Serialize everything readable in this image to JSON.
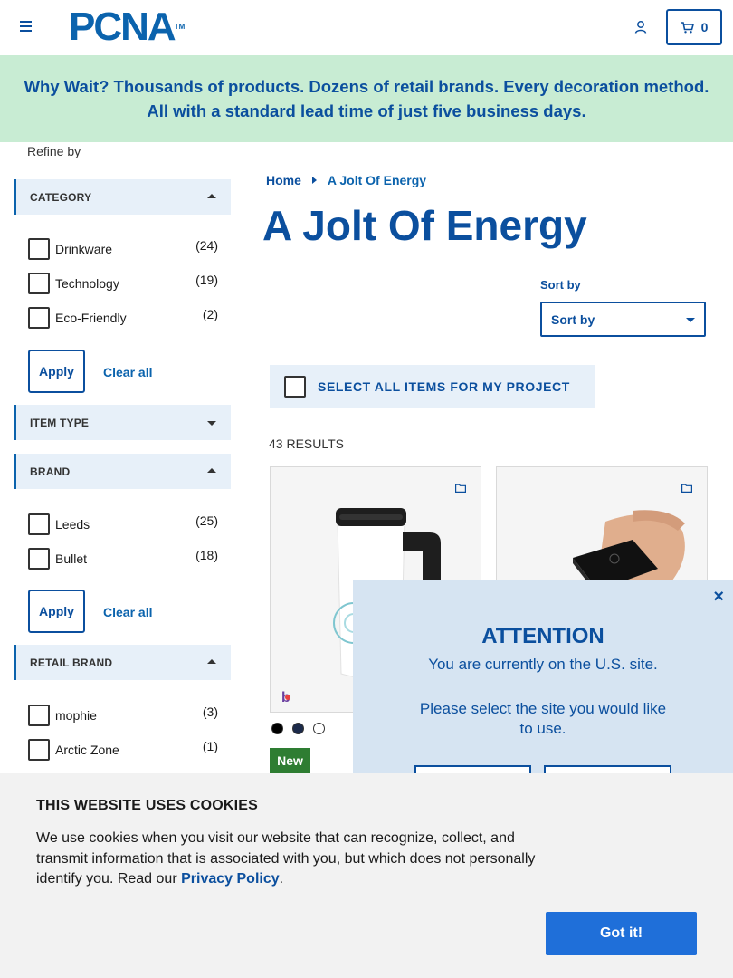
{
  "header": {
    "logo_text": "PCNA",
    "logo_tm": "TM",
    "cart_count": "0"
  },
  "banner": {
    "text": "Why Wait? Thousands of products. Dozens of retail brands. Every decoration method. All with a standard lead time of just five business days."
  },
  "sidebar": {
    "refine_label": "Refine by",
    "category": {
      "title": "CATEGORY",
      "options": [
        {
          "label": "Drinkware",
          "count": "(24)"
        },
        {
          "label": "Technology",
          "count": "(19)"
        },
        {
          "label": "Eco-Friendly",
          "count": "(2)"
        }
      ],
      "apply_label": "Apply",
      "clear_label": "Clear all"
    },
    "item_type": {
      "title": "ITEM TYPE"
    },
    "brand": {
      "title": "BRAND",
      "options": [
        {
          "label": "Leeds",
          "count": "(25)"
        },
        {
          "label": "Bullet",
          "count": "(18)"
        }
      ],
      "apply_label": "Apply",
      "clear_label": "Clear all"
    },
    "retail_brand": {
      "title": "RETAIL BRAND",
      "options": [
        {
          "label": "mophie",
          "count": "(3)"
        },
        {
          "label": "Arctic Zone",
          "count": "(1)"
        }
      ]
    }
  },
  "main": {
    "breadcrumb": {
      "home": "Home",
      "current": "A Jolt Of Energy"
    },
    "title": "A Jolt Of Energy",
    "sort_label": "Sort by",
    "sort_value": "Sort by",
    "select_all_label": "SELECT ALL ITEMS FOR MY PROJECT",
    "results": "43 RESULTS",
    "new_badge": "New",
    "swatch_colors": [
      "#000000",
      "#1c2a4a",
      "#ffffff"
    ]
  },
  "modal": {
    "title": "ATTENTION",
    "message1": "You are currently on the U.S. site.",
    "message2": "Please select the site you would like to use.",
    "close": "×"
  },
  "cookie": {
    "title": "THIS WEBSITE USES COOKIES",
    "text": "We use cookies when you visit our website that can recognize, collect, and transmit information that is associated with you, but which does not personally identify you. Read our",
    "link": "Privacy Policy",
    "period": ".",
    "button": "Got it!"
  }
}
